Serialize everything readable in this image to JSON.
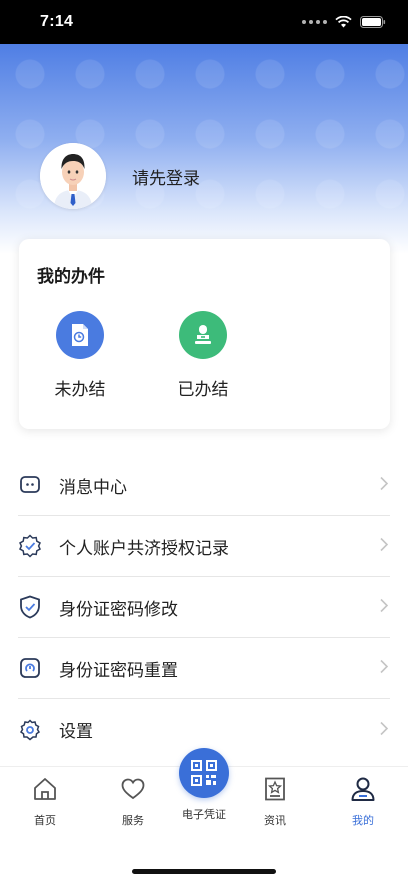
{
  "status_bar": {
    "time": "7:14"
  },
  "profile": {
    "login_prompt": "请先登录"
  },
  "my_affairs": {
    "title": "我的办件",
    "items": [
      {
        "label": "未办结",
        "icon": "document-clock-icon",
        "color": "#4a7be0"
      },
      {
        "label": "已办结",
        "icon": "stamp-icon",
        "color": "#3dbb7a"
      }
    ]
  },
  "menu": {
    "items": [
      {
        "label": "消息中心",
        "icon": "message-icon"
      },
      {
        "label": "个人账户共济授权记录",
        "icon": "badge-check-icon"
      },
      {
        "label": "身份证密码修改",
        "icon": "shield-check-icon"
      },
      {
        "label": "身份证密码重置",
        "icon": "reset-icon"
      },
      {
        "label": "设置",
        "icon": "gear-icon"
      }
    ]
  },
  "tabbar": {
    "tabs": [
      {
        "label": "首页",
        "icon": "home-icon"
      },
      {
        "label": "服务",
        "icon": "heart-icon"
      },
      {
        "label": "电子凭证",
        "icon": "qr-code-icon"
      },
      {
        "label": "资讯",
        "icon": "news-icon"
      },
      {
        "label": "我的",
        "icon": "user-icon",
        "active": true
      }
    ]
  },
  "colors": {
    "accent": "#3a6fd8",
    "header_top": "#4f7ee4"
  }
}
